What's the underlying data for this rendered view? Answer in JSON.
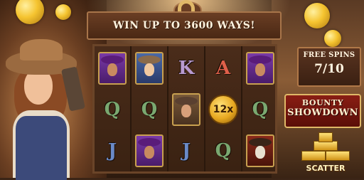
{
  "header": {
    "headline": "WIN UP TO 3600 WAYS!"
  },
  "free_spins": {
    "label": "FREE SPINS",
    "count": "7/10"
  },
  "logo": {
    "line1": "BOUNTY",
    "line2": "SHOWDOWN"
  },
  "scatter": {
    "label": "SCATTER"
  },
  "reels": [
    [
      "purple-outlaw",
      "Q",
      "J"
    ],
    [
      "blonde-cowgirl",
      "Q",
      "purple-outlaw"
    ],
    [
      "K",
      "cowboy",
      "J"
    ],
    [
      "A",
      "wild-coin",
      "Q"
    ],
    [
      "purple-outlaw",
      "Q",
      "skull-bandit"
    ]
  ],
  "wild": {
    "multiplier": "12x"
  },
  "colors": {
    "banner": "#4a2814",
    "reel_bg": "#3a2212",
    "gold": "#e8a820",
    "logo_red": "#8a1e14"
  }
}
